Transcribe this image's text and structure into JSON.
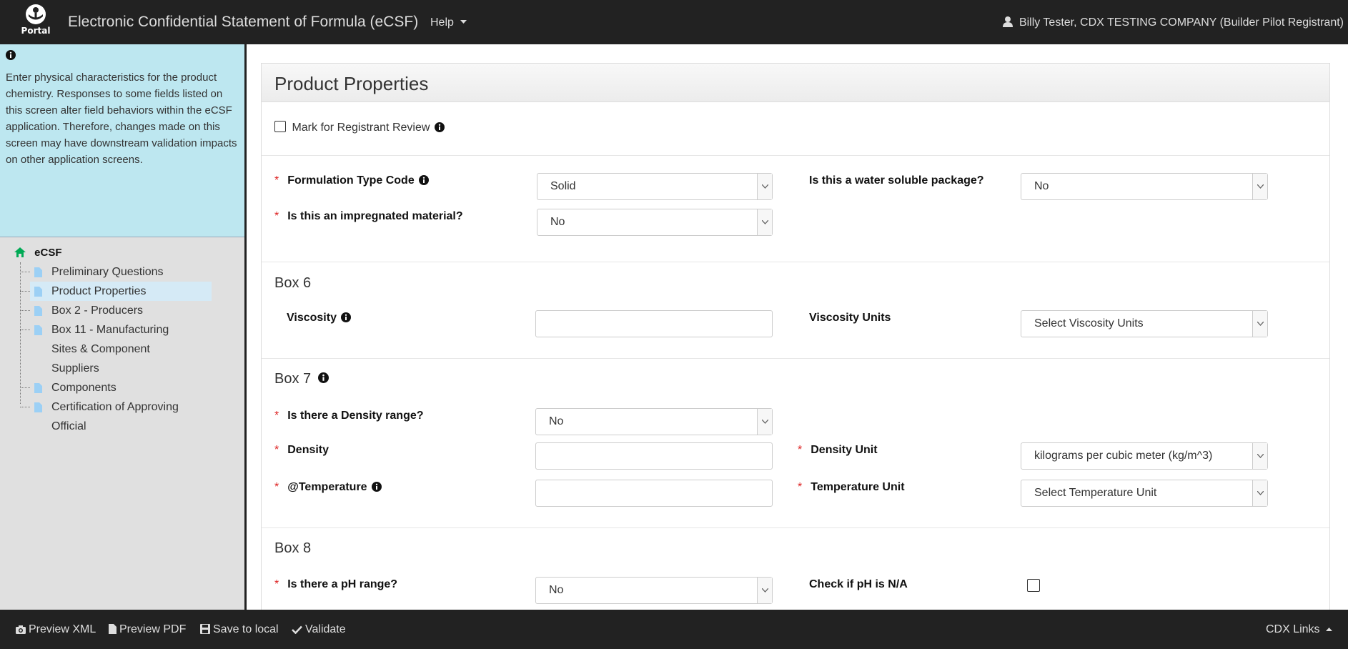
{
  "header": {
    "logo_text": "Portal",
    "app_title": "Electronic Confidential Statement of Formula (eCSF)",
    "help_label": "Help",
    "user_label": "Billy Tester, CDX TESTING COMPANY (Builder Pilot Registrant)"
  },
  "sidebar": {
    "help_text": "Enter physical characteristics for the product chemistry. Responses to some fields listed on this screen alter field behaviors within the eCSF application. Therefore, changes made on this screen may have downstream validation impacts on other application screens.",
    "tree_root": "eCSF",
    "items": [
      {
        "label": "Preliminary Questions"
      },
      {
        "label": "Product Properties"
      },
      {
        "label": "Box 2 - Producers"
      },
      {
        "label": "Box 11 - Manufacturing Sites & Component Suppliers"
      },
      {
        "label": "Components"
      },
      {
        "label": "Certification of Approving Official"
      }
    ]
  },
  "main": {
    "title": "Product Properties",
    "review_label": "Mark for Registrant Review",
    "formulation_type_label": "Formulation Type Code",
    "formulation_type_value": "Solid",
    "water_soluble_label": "Is this a water soluble package?",
    "water_soluble_value": "No",
    "impregnated_label": "Is this an impregnated material?",
    "impregnated_value": "No",
    "box6": {
      "title": "Box 6",
      "viscosity_label": "Viscosity",
      "viscosity_units_label": "Viscosity Units",
      "viscosity_units_value": "Select Viscosity Units"
    },
    "box7": {
      "title": "Box 7",
      "density_range_label": "Is there a Density range?",
      "density_range_value": "No",
      "density_label": "Density",
      "density_unit_label": "Density Unit",
      "density_unit_value": "kilograms per cubic meter (kg/m^3)",
      "temperature_label": "@Temperature",
      "temperature_unit_label": "Temperature Unit",
      "temperature_unit_value": "Select Temperature Unit"
    },
    "box8": {
      "title": "Box 8",
      "ph_range_label": "Is there a pH range?",
      "ph_range_value": "No",
      "ph_na_label": "Check if pH is N/A"
    }
  },
  "footer": {
    "preview_xml": "Preview XML",
    "preview_pdf": "Preview PDF",
    "save_local": "Save to local",
    "validate": "Validate",
    "cdx_links": "CDX Links"
  }
}
